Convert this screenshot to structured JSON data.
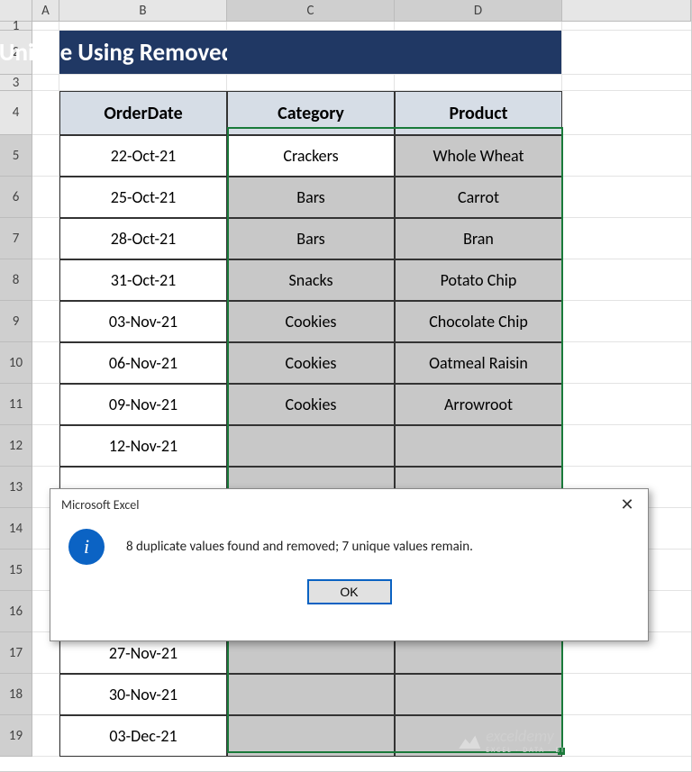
{
  "columns": {
    "A": "A",
    "B": "B",
    "C": "C",
    "D": "D"
  },
  "rownums": {
    "r1": "1",
    "r2": "2",
    "r3": "3",
    "r4": "4",
    "r5": "5",
    "r6": "6",
    "r7": "7",
    "r8": "8",
    "r9": "9",
    "r10": "10",
    "r11": "11",
    "r12": "12",
    "r13": "13",
    "r14": "14",
    "r15": "15",
    "r16": "16",
    "r17": "17",
    "r18": "18",
    "r19": "19"
  },
  "title": "Filter Unique Using Removed Duplicates",
  "headers": {
    "orderdate": "OrderDate",
    "category": "Category",
    "product": "Product"
  },
  "rows": [
    {
      "date": "22-Oct-21",
      "category": "Crackers",
      "product": "Whole Wheat"
    },
    {
      "date": "25-Oct-21",
      "category": "Bars",
      "product": "Carrot"
    },
    {
      "date": "28-Oct-21",
      "category": "Bars",
      "product": "Bran"
    },
    {
      "date": "31-Oct-21",
      "category": "Snacks",
      "product": "Potato Chip"
    },
    {
      "date": "03-Nov-21",
      "category": "Cookies",
      "product": "Chocolate Chip"
    },
    {
      "date": "06-Nov-21",
      "category": "Cookies",
      "product": "Oatmeal Raisin"
    },
    {
      "date": "09-Nov-21",
      "category": "Cookies",
      "product": "Arrowroot"
    },
    {
      "date": "12-Nov-21",
      "category": "",
      "product": ""
    },
    {
      "date": "",
      "category": "",
      "product": ""
    },
    {
      "date": "",
      "category": "",
      "product": ""
    },
    {
      "date": "",
      "category": "",
      "product": ""
    },
    {
      "date": "",
      "category": "",
      "product": ""
    },
    {
      "date": "27-Nov-21",
      "category": "",
      "product": ""
    },
    {
      "date": "30-Nov-21",
      "category": "",
      "product": ""
    },
    {
      "date": "03-Dec-21",
      "category": "",
      "product": ""
    }
  ],
  "dialog": {
    "title": "Microsoft Excel",
    "message": "8 duplicate values found and removed; 7 unique values remain.",
    "ok": "OK",
    "close": "✕",
    "info_glyph": "i"
  },
  "watermark": {
    "text": "exceldemy",
    "sub": "EXCEL · DATA · BI"
  }
}
